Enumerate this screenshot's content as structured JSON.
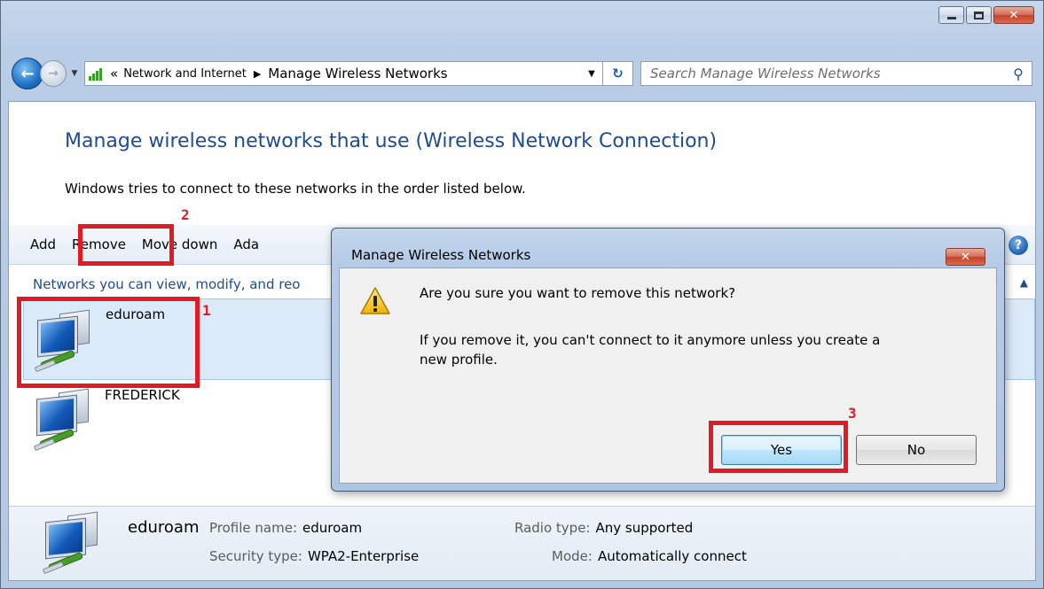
{
  "window": {
    "caption": {
      "minimize": "minimize-button",
      "maximize": "maximize-button",
      "close": "close-button"
    }
  },
  "address_bar": {
    "overflow": "«",
    "crumbs": [
      "Network and Internet",
      "Manage Wireless Networks"
    ],
    "search_placeholder": "Search Manage Wireless Networks"
  },
  "page": {
    "title": "Manage wireless networks that use (Wireless Network Connection)",
    "description": "Windows tries to connect to these networks in the order listed below."
  },
  "toolbar": {
    "items": [
      "Add",
      "Remove",
      "Move down",
      "Ada"
    ]
  },
  "group": {
    "header": "Networks you can view, modify, and reo"
  },
  "networks": [
    {
      "name": "eduroam",
      "selected": true
    },
    {
      "name": "FREDERICK",
      "selected": false
    }
  ],
  "details": {
    "name": "eduroam",
    "profile_label": "Profile name:",
    "profile_value": "eduroam",
    "security_label": "Security type:",
    "security_value": "WPA2-Enterprise",
    "radio_label": "Radio type:",
    "radio_value": "Any supported",
    "mode_label": "Mode:",
    "mode_value": "Automatically connect"
  },
  "dialog": {
    "title": "Manage Wireless Networks",
    "question": "Are you sure you want to remove this network?",
    "message": "If you remove it, you can't connect to it anymore unless you create a new profile.",
    "yes_label": "Yes",
    "no_label": "No"
  },
  "annotations": {
    "step1": "1",
    "step2": "2",
    "step3": "3",
    "color": "#e01b24"
  }
}
